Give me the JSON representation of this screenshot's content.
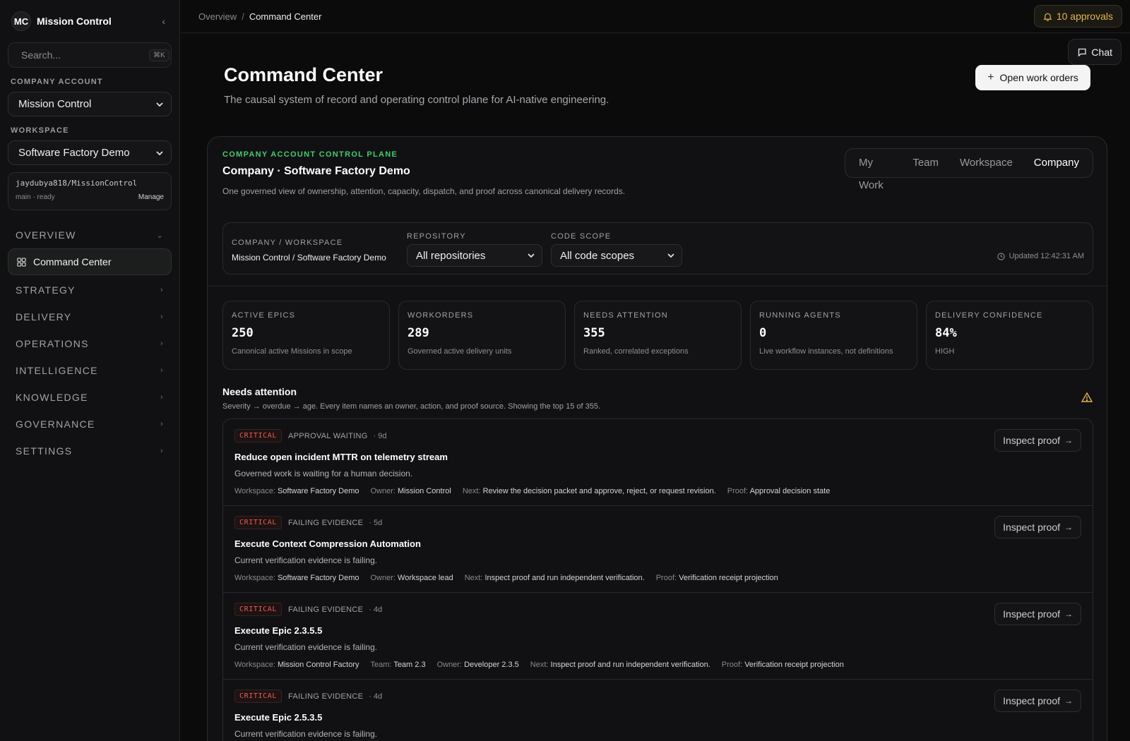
{
  "sidebar": {
    "logo": "MC",
    "brand": "Mission Control",
    "search_placeholder": "Search...",
    "search_shortcut": "⌘K",
    "company_account_label": "COMPANY ACCOUNT",
    "company_account_value": "Mission Control",
    "workspace_label": "WORKSPACE",
    "workspace_value": "Software Factory Demo",
    "repo": {
      "name": "jaydubya818/MissionControl",
      "status": "main · ready",
      "manage": "Manage"
    },
    "nav": {
      "overview": "OVERVIEW",
      "active_item": "Command Center",
      "groups": [
        "STRATEGY",
        "DELIVERY",
        "OPERATIONS",
        "INTELLIGENCE",
        "KNOWLEDGE",
        "GOVERNANCE",
        "SETTINGS"
      ]
    }
  },
  "topbar": {
    "breadcrumb_root": "Overview",
    "breadcrumb_sep": "/",
    "breadcrumb_current": "Command Center",
    "approvals": "10 approvals",
    "approvals_color": "#e3b54a",
    "chat": "Chat"
  },
  "header": {
    "title": "Command Center",
    "subtitle": "The causal system of record and operating control plane for AI-native engineering.",
    "primary_action": "Open work orders"
  },
  "card": {
    "eyebrow": "COMPANY ACCOUNT CONTROL PLANE",
    "eyebrow_color": "#3ecf6e",
    "title": "Company · Software Factory Demo",
    "description": "One governed view of ownership, attention, capacity, dispatch, and proof across canonical delivery records.",
    "scopes": [
      "My Work",
      "Team",
      "Workspace",
      "Company"
    ],
    "active_scope": "Company",
    "filters": {
      "company_label": "COMPANY / WORKSPACE",
      "company_value": "Mission Control / Software Factory Demo",
      "repo_label": "REPOSITORY",
      "repo_value": "All repositories",
      "scope_label": "CODE SCOPE",
      "scope_value": "All code scopes",
      "updated": "Updated 12:42:31 AM"
    },
    "kpis": [
      {
        "label": "ACTIVE EPICS",
        "value": "250",
        "sub": "Canonical active Missions in scope"
      },
      {
        "label": "WORKORDERS",
        "value": "289",
        "sub": "Governed active delivery units"
      },
      {
        "label": "NEEDS ATTENTION",
        "value": "355",
        "sub": "Ranked, correlated exceptions"
      },
      {
        "label": "RUNNING AGENTS",
        "value": "0",
        "sub": "Live workflow instances, not definitions"
      },
      {
        "label": "DELIVERY CONFIDENCE",
        "value": "84%",
        "sub": "HIGH"
      }
    ],
    "needs_attention": {
      "title": "Needs attention",
      "subtitle": "Severity → overdue → age. Every item names an owner, action, and proof source. Showing the top 15 of 355.",
      "inspect_label": "Inspect proof",
      "items": [
        {
          "severity": "CRITICAL",
          "kind": "APPROVAL WAITING",
          "age": "· 9d",
          "title": "Reduce open incident MTTR on telemetry stream",
          "desc": "Governed work is waiting for a human decision.",
          "meta": [
            {
              "k": "Workspace:",
              "v": "Software Factory Demo"
            },
            {
              "k": "Owner:",
              "v": "Mission Control"
            },
            {
              "k": "Next:",
              "v": "Review the decision packet and approve, reject, or request revision."
            },
            {
              "k": "Proof:",
              "v": "Approval decision state"
            }
          ]
        },
        {
          "severity": "CRITICAL",
          "kind": "FAILING EVIDENCE",
          "age": "· 5d",
          "title": "Execute Context Compression Automation",
          "desc": "Current verification evidence is failing.",
          "meta": [
            {
              "k": "Workspace:",
              "v": "Software Factory Demo"
            },
            {
              "k": "Owner:",
              "v": "Workspace lead"
            },
            {
              "k": "Next:",
              "v": "Inspect proof and run independent verification."
            },
            {
              "k": "Proof:",
              "v": "Verification receipt projection"
            }
          ]
        },
        {
          "severity": "CRITICAL",
          "kind": "FAILING EVIDENCE",
          "age": "· 4d",
          "title": "Execute Epic 2.3.5.5",
          "desc": "Current verification evidence is failing.",
          "meta": [
            {
              "k": "Workspace:",
              "v": "Mission Control Factory"
            },
            {
              "k": "Team:",
              "v": "Team 2.3"
            },
            {
              "k": "Owner:",
              "v": "Developer 2.3.5"
            },
            {
              "k": "Next:",
              "v": "Inspect proof and run independent verification."
            },
            {
              "k": "Proof:",
              "v": "Verification receipt projection"
            }
          ]
        },
        {
          "severity": "CRITICAL",
          "kind": "FAILING EVIDENCE",
          "age": "· 4d",
          "title": "Execute Epic 2.5.3.5",
          "desc": "Current verification evidence is failing.",
          "meta": []
        }
      ]
    }
  }
}
